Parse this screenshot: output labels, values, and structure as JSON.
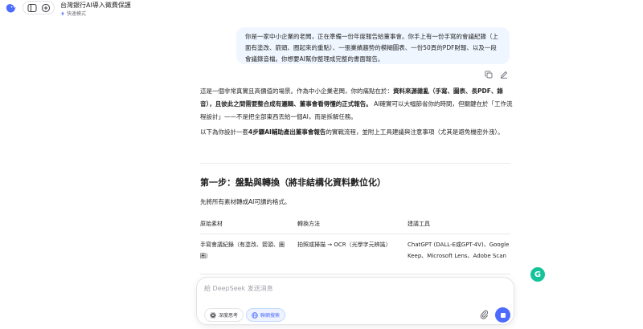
{
  "header": {
    "title": "台灣銀行AI導入徵費保護",
    "mode": "快速模式"
  },
  "user_message": {
    "text": "你是一家中小企業的老闆，正在準備一份年度報告給董事會。你手上有一份手寫的會議紀錄（上面有塗改、箭頭、圈起來的重點）、一張業績趨勢的模糊圖表、一份50頁的PDF財報、以及一段會議錄音檔。你想要AI幫你整理成完整的書面報告。"
  },
  "response": {
    "p1_a": "這是一個非常真實且高價值的場景。作為中小企業老闆，你的痛點在於：",
    "p1_b": "資料來源雜亂（手寫、圖表、長PDF、錄音），且彼此之間需要整合成有邏輯、董事會看得懂的正式報告。",
    "p1_c": " AI確實可以大幅節省你的時間，但關鍵在於「工作流程設計」——不是把全部東西丟給一個AI，而是拆解任務。",
    "p2_a": "以下為你設計一套",
    "p2_b": "4步驟AI輔助產出董事會報告",
    "p2_c": "的實戰流程，並附上工具建議與注意事項（尤其是避免機密外洩）。",
    "heading": "第一步：盤點與轉換（將非結構化資料數位化）",
    "p3": "先將所有素材轉成AI可讀的格式。"
  },
  "table": {
    "headers": [
      "原始素材",
      "轉換方法",
      "建議工具"
    ],
    "rows": [
      [
        "手寫會議紀錄（有塗改、箭頭、圈圈）",
        "拍照或掃描 → OCR（光學字元辨識）",
        "ChatGPT (DALL-E或GPT-4V)、Google Keep、Microsoft Lens、Adobe Scan"
      ]
    ]
  },
  "composer": {
    "placeholder": "給 DeepSeek 发送消息",
    "deep_think": "深度思考",
    "web_search": "聯網搜索"
  },
  "colors": {
    "accent": "#4d6bfe",
    "bubble": "#eff6ff",
    "grammarly": "#15c39a"
  },
  "icons": [
    "deepseek-logo-icon",
    "sidebar-toggle-icon",
    "new-chat-icon",
    "bolt-icon",
    "copy-icon",
    "edit-icon",
    "atom-icon",
    "globe-icon",
    "paperclip-icon",
    "stop-icon",
    "grammarly-icon"
  ],
  "grammarly_letter": "G"
}
